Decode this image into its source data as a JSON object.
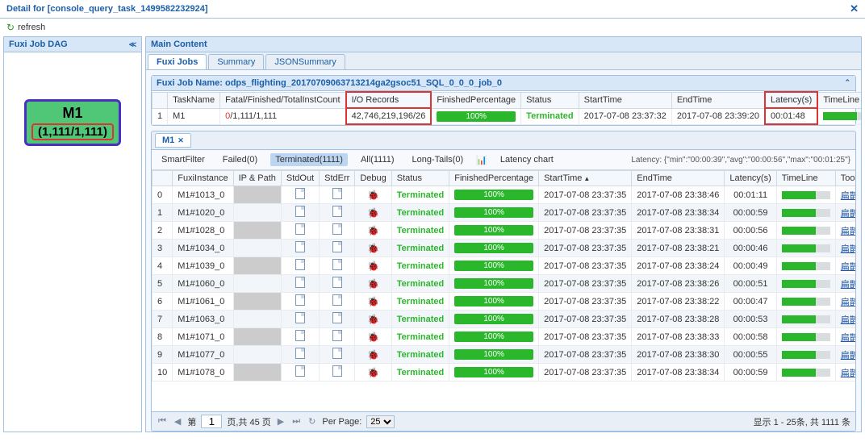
{
  "window": {
    "title": "Detail for [console_query_task_1499582232924]"
  },
  "refresh": {
    "label": "refresh"
  },
  "leftPanel": {
    "title": "Fuxi Job DAG"
  },
  "dag": {
    "label": "M1",
    "count": "(1,111/1,111)"
  },
  "mainContent": {
    "title": "Main Content"
  },
  "tabs": {
    "fuxi": "Fuxi Jobs",
    "summary": "Summary",
    "jsonSummary": "JSONSummary"
  },
  "fuxiJob": {
    "titlePrefix": "Fuxi Job Name: ",
    "name": "odps_flighting_20170709063713214ga2gsoc51_SQL_0_0_0_job_0",
    "headers": {
      "idx": "",
      "task": "TaskName",
      "fatal": "Fatal/Finished/TotalInstCount",
      "io": "I/O Records",
      "fp": "FinishedPercentage",
      "status": "Status",
      "start": "StartTime",
      "end": "EndTime",
      "lat": "Latency(s)",
      "tl": "TimeLine"
    },
    "row": {
      "idx": "1",
      "task": "M1",
      "fatalZero": "0",
      "fatalRest": "/1,111/1,111",
      "io": "42,746,219,196/26",
      "fp": "100%",
      "status": "Terminated",
      "start": "2017-07-08 23:37:32",
      "end": "2017-07-08 23:39:20",
      "lat": "00:01:48"
    }
  },
  "m1Tab": {
    "label": "M1"
  },
  "filters": {
    "smart": "SmartFilter",
    "failed": "Failed(0)",
    "terminated": "Terminated(1111)",
    "all": "All(1111)",
    "longtails": "Long-Tails(0)",
    "chart": "Latency chart"
  },
  "latencyInfo": "Latency: {\"min\":\"00:00:39\",\"avg\":\"00:00:56\",\"max\":\"00:01:25\"}",
  "instHeaders": {
    "idx": "",
    "inst": "FuxiInstance",
    "ip": "IP & Path",
    "stdout": "StdOut",
    "stderr": "StdErr",
    "debug": "Debug",
    "status": "Status",
    "fp": "FinishedPercentage",
    "start": "StartTime",
    "end": "EndTime",
    "lat": "Latency(s)",
    "tl": "TimeLine",
    "tool": "Tool"
  },
  "instances": [
    {
      "i": "0",
      "name": "M1#1013_0",
      "status": "Terminated",
      "fp": "100%",
      "start": "2017-07-08 23:37:35",
      "end": "2017-07-08 23:38:46",
      "lat": "00:01:11",
      "tool": "扁鹊"
    },
    {
      "i": "1",
      "name": "M1#1020_0",
      "status": "Terminated",
      "fp": "100%",
      "start": "2017-07-08 23:37:35",
      "end": "2017-07-08 23:38:34",
      "lat": "00:00:59",
      "tool": "扁鹊"
    },
    {
      "i": "2",
      "name": "M1#1028_0",
      "status": "Terminated",
      "fp": "100%",
      "start": "2017-07-08 23:37:35",
      "end": "2017-07-08 23:38:31",
      "lat": "00:00:56",
      "tool": "扁鹊"
    },
    {
      "i": "3",
      "name": "M1#1034_0",
      "status": "Terminated",
      "fp": "100%",
      "start": "2017-07-08 23:37:35",
      "end": "2017-07-08 23:38:21",
      "lat": "00:00:46",
      "tool": "扁鹊"
    },
    {
      "i": "4",
      "name": "M1#1039_0",
      "status": "Terminated",
      "fp": "100%",
      "start": "2017-07-08 23:37:35",
      "end": "2017-07-08 23:38:24",
      "lat": "00:00:49",
      "tool": "扁鹊"
    },
    {
      "i": "5",
      "name": "M1#1060_0",
      "status": "Terminated",
      "fp": "100%",
      "start": "2017-07-08 23:37:35",
      "end": "2017-07-08 23:38:26",
      "lat": "00:00:51",
      "tool": "扁鹊"
    },
    {
      "i": "6",
      "name": "M1#1061_0",
      "status": "Terminated",
      "fp": "100%",
      "start": "2017-07-08 23:37:35",
      "end": "2017-07-08 23:38:22",
      "lat": "00:00:47",
      "tool": "扁鹊"
    },
    {
      "i": "7",
      "name": "M1#1063_0",
      "status": "Terminated",
      "fp": "100%",
      "start": "2017-07-08 23:37:35",
      "end": "2017-07-08 23:38:28",
      "lat": "00:00:53",
      "tool": "扁鹊"
    },
    {
      "i": "8",
      "name": "M1#1071_0",
      "status": "Terminated",
      "fp": "100%",
      "start": "2017-07-08 23:37:35",
      "end": "2017-07-08 23:38:33",
      "lat": "00:00:58",
      "tool": "扁鹊"
    },
    {
      "i": "9",
      "name": "M1#1077_0",
      "status": "Terminated",
      "fp": "100%",
      "start": "2017-07-08 23:37:35",
      "end": "2017-07-08 23:38:30",
      "lat": "00:00:55",
      "tool": "扁鹊"
    },
    {
      "i": "10",
      "name": "M1#1078_0",
      "status": "Terminated",
      "fp": "100%",
      "start": "2017-07-08 23:37:35",
      "end": "2017-07-08 23:38:34",
      "lat": "00:00:59",
      "tool": "扁鹊"
    }
  ],
  "pager": {
    "pageLabel1": "第",
    "page": "1",
    "pageLabel2": "页,共 45 页",
    "perPage": "Per Page:",
    "perPageVal": "25",
    "info": "显示 1 - 25条, 共 1111 条"
  }
}
